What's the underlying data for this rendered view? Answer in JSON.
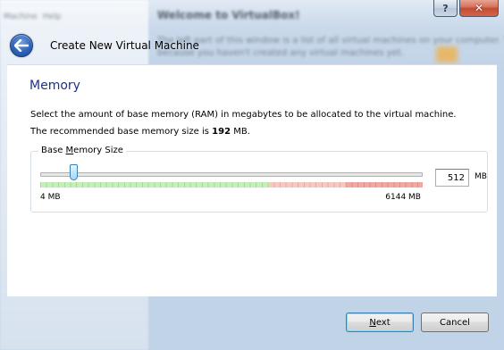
{
  "background": {
    "title": "Welcome to VirtualBox!",
    "line1": "The left part of this window is a list of all virtual machines on your computer. The list is empty now",
    "line2": "because you haven't created any virtual machines yet.",
    "menu1": "Machine",
    "menu2": "Help"
  },
  "window": {
    "help_button": "?",
    "close_button": "✕"
  },
  "header": {
    "back_icon": "back-arrow-icon",
    "title": "Create New Virtual Machine"
  },
  "page": {
    "title": "Memory",
    "description": "Select the amount of base memory (RAM) in megabytes to be allocated to the virtual machine.",
    "recommended_prefix": "The recommended base memory size is ",
    "recommended_value": "192",
    "recommended_suffix": " MB."
  },
  "memory_group": {
    "label_prefix": "Base ",
    "label_underlined": "M",
    "label_suffix": "emory Size",
    "slider_min_value": 4,
    "slider_max_value": 6144,
    "slider_value": 512,
    "min_label": "4 MB",
    "max_label": "6144 MB",
    "input_value": "512",
    "unit": "MB",
    "scale_colors": {
      "green": "#c4f0b6",
      "red": "#f8c8c0",
      "dark_red": "#f0a8a0"
    },
    "green_fraction": 0.6,
    "red_fraction": 0.2
  },
  "footer": {
    "next_underlined": "N",
    "next_rest": "ext",
    "cancel_label": "Cancel"
  }
}
